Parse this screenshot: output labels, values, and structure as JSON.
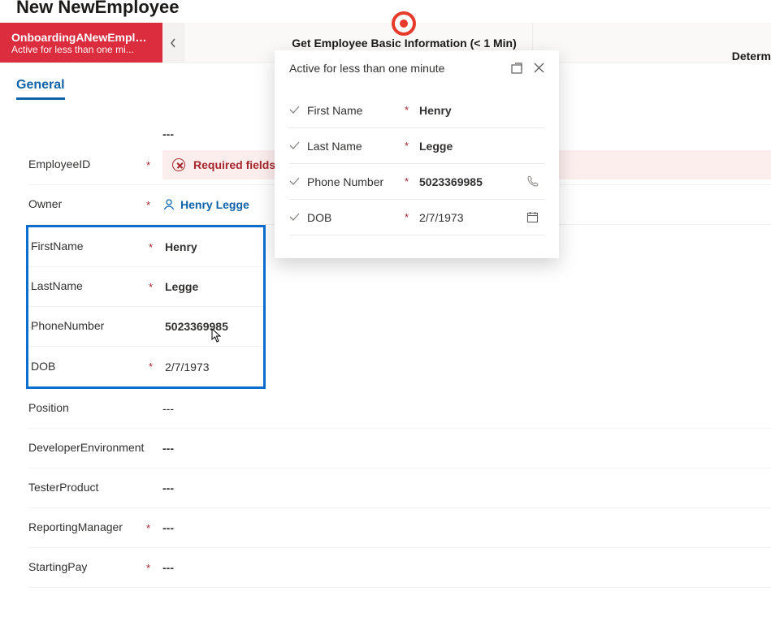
{
  "page_title": "New NewEmployee",
  "stages": {
    "active": {
      "title": "OnboardingANewEmplo...",
      "sub": "Active for less than one mi..."
    },
    "middle": "Get Employee Basic Information  (< 1 Min)",
    "right": "Determ"
  },
  "tab": "General",
  "fields": {
    "employee_id": {
      "label": "EmployeeID",
      "value": "---",
      "required": true
    },
    "error_text": "Required fields",
    "owner_label": "Owner",
    "owner_value": "Henry Legge",
    "first_name": {
      "label": "FirstName",
      "value": "Henry",
      "required": true
    },
    "last_name": {
      "label": "LastName",
      "value": "Legge",
      "required": true
    },
    "phone": {
      "label": "PhoneNumber",
      "value": "5023369985",
      "required": false
    },
    "dob": {
      "label": "DOB",
      "value": "2/7/1973",
      "required": true
    },
    "position": {
      "label": "Position",
      "value": "---",
      "required": false
    },
    "dev_env": {
      "label": "DeveloperEnvironment",
      "value": "---",
      "required": false
    },
    "tester": {
      "label": "TesterProduct",
      "value": "---",
      "required": false
    },
    "reporting": {
      "label": "ReportingManager",
      "value": "---",
      "required": true
    },
    "starting_pay": {
      "label": "StartingPay",
      "value": "---",
      "required": true
    }
  },
  "flyout": {
    "title": "Active for less than one minute",
    "first_name": {
      "label": "First Name",
      "value": "Henry"
    },
    "last_name": {
      "label": "Last Name",
      "value": "Legge"
    },
    "phone": {
      "label": "Phone Number",
      "value": "5023369985"
    },
    "dob": {
      "label": "DOB",
      "value": "2/7/1973"
    }
  }
}
